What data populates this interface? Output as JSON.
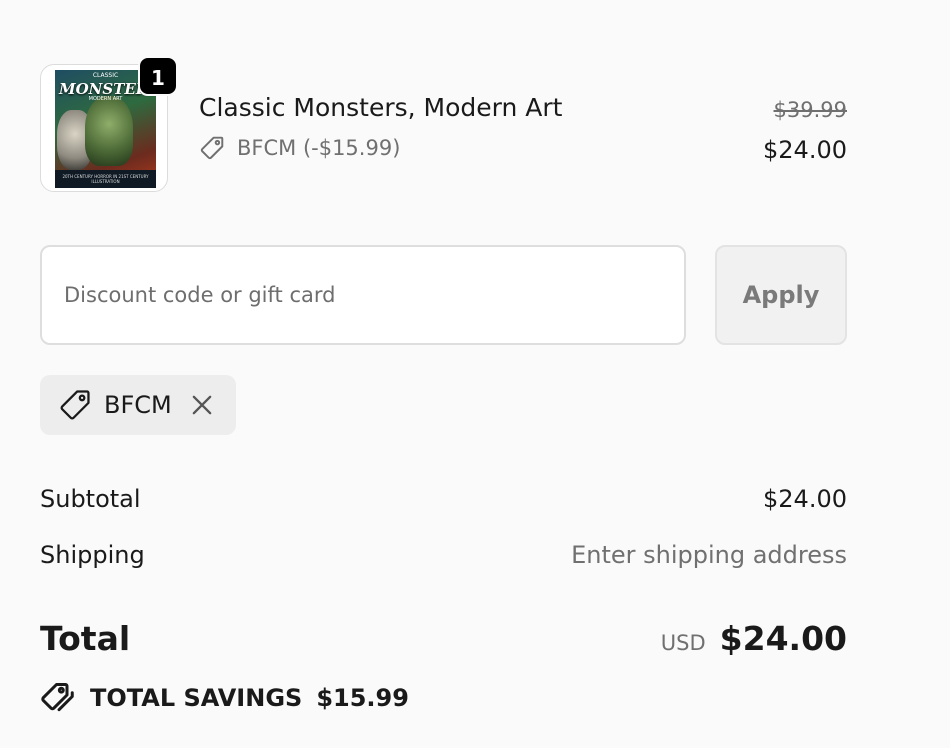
{
  "line_item": {
    "quantity": "1",
    "cover": {
      "top_text": "CLASSIC",
      "title_text": "MONSTERS",
      "subtitle_text": "MODERN ART",
      "footer_text": "20TH CENTURY HORROR IN 21ST CENTURY ILLUSTRATION"
    },
    "name": "Classic Monsters, Modern Art",
    "discount": "BFCM (-$15.99)",
    "original_price": "$39.99",
    "price": "$24.00"
  },
  "discount_form": {
    "placeholder": "Discount code or gift card",
    "value": "",
    "apply_label": "Apply"
  },
  "applied_code": {
    "code": "BFCM"
  },
  "summary": {
    "subtotal_label": "Subtotal",
    "subtotal_value": "$24.00",
    "shipping_label": "Shipping",
    "shipping_value": "Enter shipping address"
  },
  "total": {
    "label": "Total",
    "currency": "USD",
    "amount": "$24.00"
  },
  "savings": {
    "label": "TOTAL SAVINGS",
    "amount": "$15.99"
  },
  "icons": {
    "discount_tag": "tag-icon",
    "remove_code": "close-icon",
    "savings": "tags-icon"
  },
  "colors": {
    "background": "#fafafa",
    "muted_text": "#707070",
    "badge": "#000000",
    "chip_background": "#ededed"
  }
}
